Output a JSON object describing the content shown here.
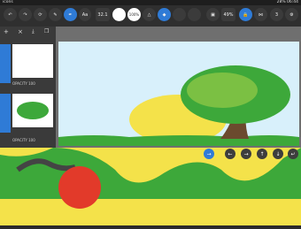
{
  "status": {
    "left": "icons",
    "right": "28% 06:44"
  },
  "toolbar": {
    "back_icon": "back-arrow-icon",
    "forward_icon": "forward-arrow-icon",
    "tool_text": "Aa",
    "brush_size": "32.1",
    "opacity": "100%",
    "zoom": "49%",
    "count": "3"
  },
  "layers": [
    {
      "label": "OPACITY 100"
    },
    {
      "label": "OPACITY 100"
    }
  ],
  "colors": {
    "accent": "#2f7bd6",
    "sky": "#d8f0fb",
    "leaf": "#3da83a",
    "yellow": "#f4e24a",
    "red": "#e23a2a"
  }
}
